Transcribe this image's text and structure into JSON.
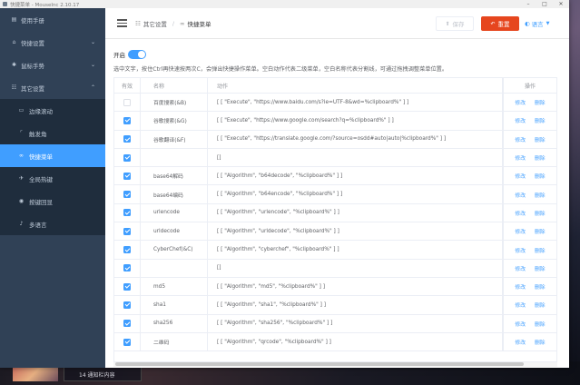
{
  "window": {
    "title": "快捷菜单 - MouseInc 2.10.17",
    "controls": [
      "–",
      "□",
      "✕"
    ]
  },
  "sidebar": {
    "items": [
      {
        "label": "使用手册",
        "icon": "document-icon",
        "glyph": "▤"
      },
      {
        "label": "快捷设置",
        "icon": "home-icon",
        "glyph": "⌂",
        "chevron": "⌄"
      },
      {
        "label": "鼠标手势",
        "icon": "gear-icon",
        "glyph": "✱",
        "chevron": "⌄"
      },
      {
        "label": "其它设置",
        "icon": "sliders-icon",
        "glyph": "☷",
        "chevron": "⌃"
      }
    ],
    "sub_items": [
      {
        "label": "边缘滚动",
        "icon": "monitor-icon",
        "glyph": "▭"
      },
      {
        "label": "触发角",
        "icon": "corners-icon",
        "glyph": "⌜"
      },
      {
        "label": "快捷菜单",
        "icon": "link-icon",
        "glyph": "∞",
        "active": true
      },
      {
        "label": "全局热键",
        "icon": "bolt-icon",
        "glyph": "✈"
      },
      {
        "label": "按键回显",
        "icon": "keyboard-icon",
        "glyph": "◉"
      },
      {
        "label": "多语言",
        "icon": "microphone-icon",
        "glyph": "♪"
      }
    ]
  },
  "header": {
    "hamburger_icon": "menu-icon",
    "breadcrumb": {
      "parent": "其它设置",
      "parent_glyph": "☷",
      "separator": "/",
      "current": "快捷菜单",
      "current_glyph": "∞"
    },
    "save_label": "保存",
    "save_glyph": "⬆",
    "reset_label": "重置",
    "reset_glyph": "↶",
    "language_label": "语言",
    "language_glyph": "◐",
    "language_caret": "▼"
  },
  "toggle": {
    "label": "开启",
    "on": true
  },
  "hint": "选中文字，按住Ctrl再快速按两次C，会弹出快捷操作菜单。空白动作代表二级菜单，空白名称代表分割线，可通过拖拽调整菜单位置。",
  "table": {
    "columns": {
      "enabled": "有效",
      "name": "名称",
      "action": "动作",
      "ops": "操作"
    },
    "edit_label": "修改",
    "delete_label": "删除",
    "rows": [
      {
        "enabled": false,
        "name": "百度搜索(&B)",
        "action": "[ [ \"Execute\", \"https://www.baidu.com/s?ie=UTF-8&wd=%clipboard%\" ] ]"
      },
      {
        "enabled": true,
        "name": "谷歌搜索(&G)",
        "action": "[ [ \"Execute\", \"https://www.google.com/search?q=%clipboard%\" ] ]"
      },
      {
        "enabled": true,
        "name": "谷歌翻译(&F)",
        "action": "[ [ \"Execute\", \"https://translate.google.com/?source=osdd#auto|auto|%clipboard%\" ] ]"
      },
      {
        "enabled": true,
        "name": "",
        "action": "[]"
      },
      {
        "enabled": true,
        "name": "base64解码",
        "action": "[ [ \"Algorithm\", \"b64decode\", \"%clipboard%\" ] ]"
      },
      {
        "enabled": true,
        "name": "base64编码",
        "action": "[ [ \"Algorithm\", \"b64encode\", \"%clipboard%\" ] ]"
      },
      {
        "enabled": true,
        "name": "urlencode",
        "action": "[ [ \"Algorithm\", \"urlencode\", \"%clipboard%\" ] ]"
      },
      {
        "enabled": true,
        "name": "urldecode",
        "action": "[ [ \"Algorithm\", \"urldecode\", \"%clipboard%\" ] ]"
      },
      {
        "enabled": true,
        "name": "CyberChef(&C)",
        "action": "[ [ \"Algorithm\", \"cyberchef\", \"%clipboard%\" ] ]"
      },
      {
        "enabled": true,
        "name": "",
        "action": "[]"
      },
      {
        "enabled": true,
        "name": "md5",
        "action": "[ [ \"Algorithm\", \"md5\", \"%clipboard%\" ] ]"
      },
      {
        "enabled": true,
        "name": "sha1",
        "action": "[ [ \"Algorithm\", \"sha1\", \"%clipboard%\" ] ]"
      },
      {
        "enabled": true,
        "name": "sha256",
        "action": "[ [ \"Algorithm\", \"sha256\", \"%clipboard%\" ] ]"
      },
      {
        "enabled": true,
        "name": "二维码",
        "action": "[ [ \"Algorithm\", \"qrcode\", \"%clipboard%\" ] ]"
      }
    ]
  },
  "desktop": {
    "taskbar_text": "14 通知栏内容"
  },
  "colors": {
    "primary": "#409eff",
    "danger": "#e6461e",
    "sidebar": "#304156",
    "submenu": "#1f2d3d"
  }
}
